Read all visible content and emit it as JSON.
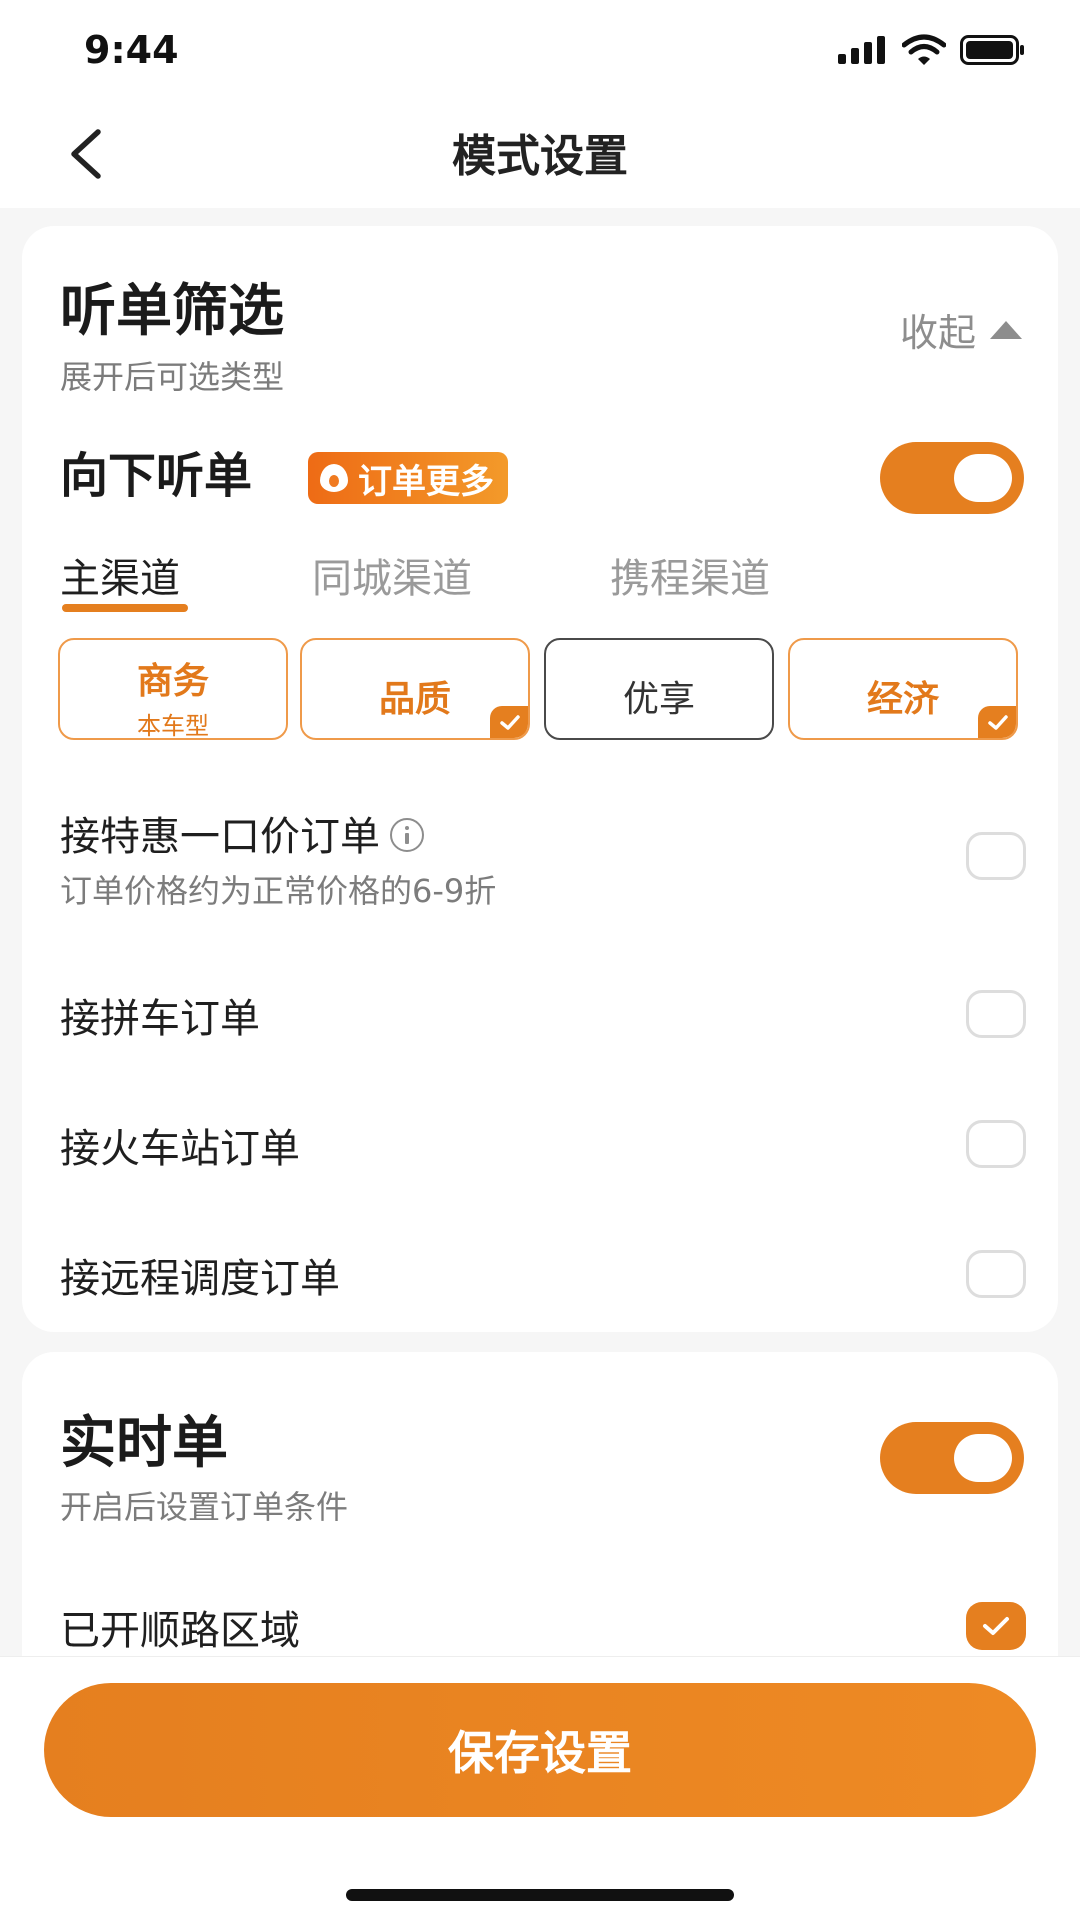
{
  "status": {
    "time": "9:44"
  },
  "nav": {
    "title": "模式设置"
  },
  "filter": {
    "title": "听单筛选",
    "subtitle": "展开后可选类型",
    "collapse_label": "收起",
    "downward": {
      "label": "向下听单",
      "badge": "订单更多",
      "enabled": true
    },
    "tabs": [
      {
        "label": "主渠道",
        "active": true
      },
      {
        "label": "同城渠道",
        "active": false
      },
      {
        "label": "携程渠道",
        "active": false
      }
    ],
    "chips": [
      {
        "label": "商务",
        "sub": "本车型",
        "selected": false,
        "style": "orange"
      },
      {
        "label": "品质",
        "sub": "",
        "selected": true,
        "style": "orange"
      },
      {
        "label": "优享",
        "sub": "",
        "selected": false,
        "style": "grey"
      },
      {
        "label": "经济",
        "sub": "",
        "selected": true,
        "style": "orange"
      }
    ],
    "options": [
      {
        "label": "接特惠一口价订单",
        "sub": "订单价格约为正常价格的6-9折",
        "checked": false
      },
      {
        "label": "接拼车订单",
        "checked": false
      },
      {
        "label": "接火车站订单",
        "checked": false
      },
      {
        "label": "接远程调度订单",
        "checked": false
      }
    ]
  },
  "realtime": {
    "title": "实时单",
    "subtitle": "开启后设置订单条件",
    "enabled": true,
    "route_label": "已开顺路区域",
    "route_checked": true
  },
  "footer": {
    "save_label": "保存设置"
  },
  "colors": {
    "accent": "#e57f1f",
    "badge_start": "#ee6b15",
    "badge_end": "#f39a2a"
  }
}
